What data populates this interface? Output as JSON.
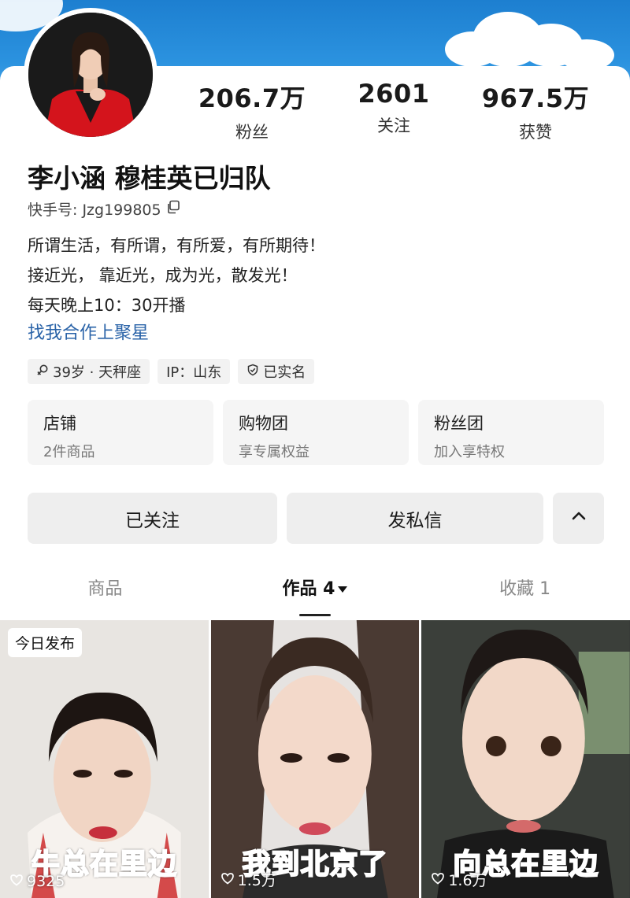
{
  "profile": {
    "name": "李小涵 穆桂英已归队",
    "kuaishou_id": "快手号: Jzg199805",
    "bio": [
      "所谓生活，有所谓，有所爱，有所期待！",
      "接近光， 靠近光，成为光，散发光！",
      "每天晚上10：30开播"
    ],
    "cooperation_link": "找我合作上聚星",
    "tags": {
      "age": "39岁 · 天秤座",
      "ip": "IP：山东",
      "verified": "已实名"
    }
  },
  "stats": [
    {
      "value": "206.7万",
      "label": "粉丝"
    },
    {
      "value": "2601",
      "label": "关注"
    },
    {
      "value": "967.5万",
      "label": "获赞"
    }
  ],
  "cards": [
    {
      "title": "店铺",
      "sub": "2件商品"
    },
    {
      "title": "购物团",
      "sub": "享专属权益"
    },
    {
      "title": "粉丝团",
      "sub": "加入享特权"
    }
  ],
  "actions": {
    "follow": "已关注",
    "message": "发私信"
  },
  "tabs": [
    {
      "label": "商品"
    },
    {
      "label": "作品 4"
    },
    {
      "label": "收藏 1"
    }
  ],
  "videos": [
    {
      "badge": "今日发布",
      "caption": "牛总在里边",
      "likes": "9325"
    },
    {
      "caption": "我到北京了",
      "likes": "1.5万"
    },
    {
      "caption": "向总在里边",
      "likes": "1.6万"
    }
  ],
  "colors": {
    "sky": "#2b92df",
    "link": "#2a63a8",
    "caption": "#e52020"
  }
}
